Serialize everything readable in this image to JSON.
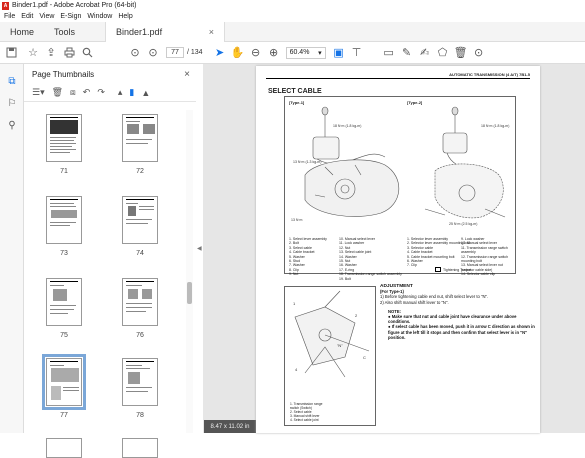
{
  "window": {
    "title": "Binder1.pdf - Adobe Acrobat Pro (64-bit)",
    "app_icon_label": "A"
  },
  "menu": [
    "File",
    "Edit",
    "View",
    "E-Sign",
    "Window",
    "Help"
  ],
  "tabs": {
    "home": "Home",
    "tools": "Tools",
    "document": "Binder1.pdf",
    "close": "×"
  },
  "toolbar": {
    "current_page": "77",
    "total_pages": "/ 134",
    "zoom": "60.4%",
    "zoom_arrow": "▾"
  },
  "thumbnails_panel": {
    "title": "Page Thumbnails",
    "close": "×",
    "thumbnails": [
      {
        "label": "71"
      },
      {
        "label": "72"
      },
      {
        "label": "73"
      },
      {
        "label": "74"
      },
      {
        "label": "75"
      },
      {
        "label": "76"
      },
      {
        "label": "77"
      },
      {
        "label": "78"
      }
    ]
  },
  "page_size": "8.47 x 11.02 in",
  "document_page": {
    "header": "AUTOMATIC TRANSMISSION (4 A/T)   7B1-5",
    "title": "SELECT CABLE",
    "type1": "[Type-1]",
    "type2": "[Type-2]",
    "legend_col1": [
      "1. Select lever assembly",
      "2. Bolt",
      "3. Select cable",
      "4. Cable bracket",
      "5. Washer",
      "6. Stud",
      "7. Washer",
      "8. Clip",
      "9. Nut"
    ],
    "legend_col2": [
      "10. Manual select lever",
      "11. Lock washer",
      "12. Nut",
      "13. Select cable joint",
      "14. Washer",
      "15. Nut",
      "16. Washer",
      "17. E-ring",
      "18. Transmission range switch assembly",
      "19. Bolt"
    ],
    "legend_col3": [
      "1. Selector lever assembly",
      "2. Selector lever assembly mounting bolt",
      "3. Selector cable",
      "4. Cable bracket",
      "5. Cable bracket mounting bolt",
      "6. Washer",
      "7. Clip",
      "8. Manual select lever nut (Transmission range switch side)"
    ],
    "legend_col4": [
      "9. Lock washer",
      "10. Manual select lever",
      "11. Transmission range switch assembly",
      "12. Transmission range switch mounting bolt",
      "13. Manual select lever nut (selector cable side)",
      "14. Selector cable clip"
    ],
    "tightening_label": "Tightening Torque",
    "adjustment": {
      "heading": "ADJUSTMENT",
      "subheading": "(For Type-1)",
      "steps": [
        "1) Before tightening cable end nut, shift select lever to \"N\".",
        "2) Also shift manual shift lever to \"N\"."
      ],
      "note_title": "NOTE:",
      "notes": [
        "● Make sure that nut and cable joint have clearance under above conditions.",
        "● If select cable has been moved, push it in arrow C direction as shown in figure at the left till it stops and then confirm that select lever is in \"N\" position."
      ]
    },
    "small_fig_legend": [
      "1. Transmission range",
      "   switch (Switch)",
      "2. Select cable",
      "3. Manual shift lever",
      "4. Select cable joint"
    ],
    "callouts": [
      "18 N·m (1.8 kg-m)",
      "13 N·m (1.3 kg-m)",
      "25 N·m (2.5 kg-m)",
      "\"N\"",
      "C"
    ]
  }
}
